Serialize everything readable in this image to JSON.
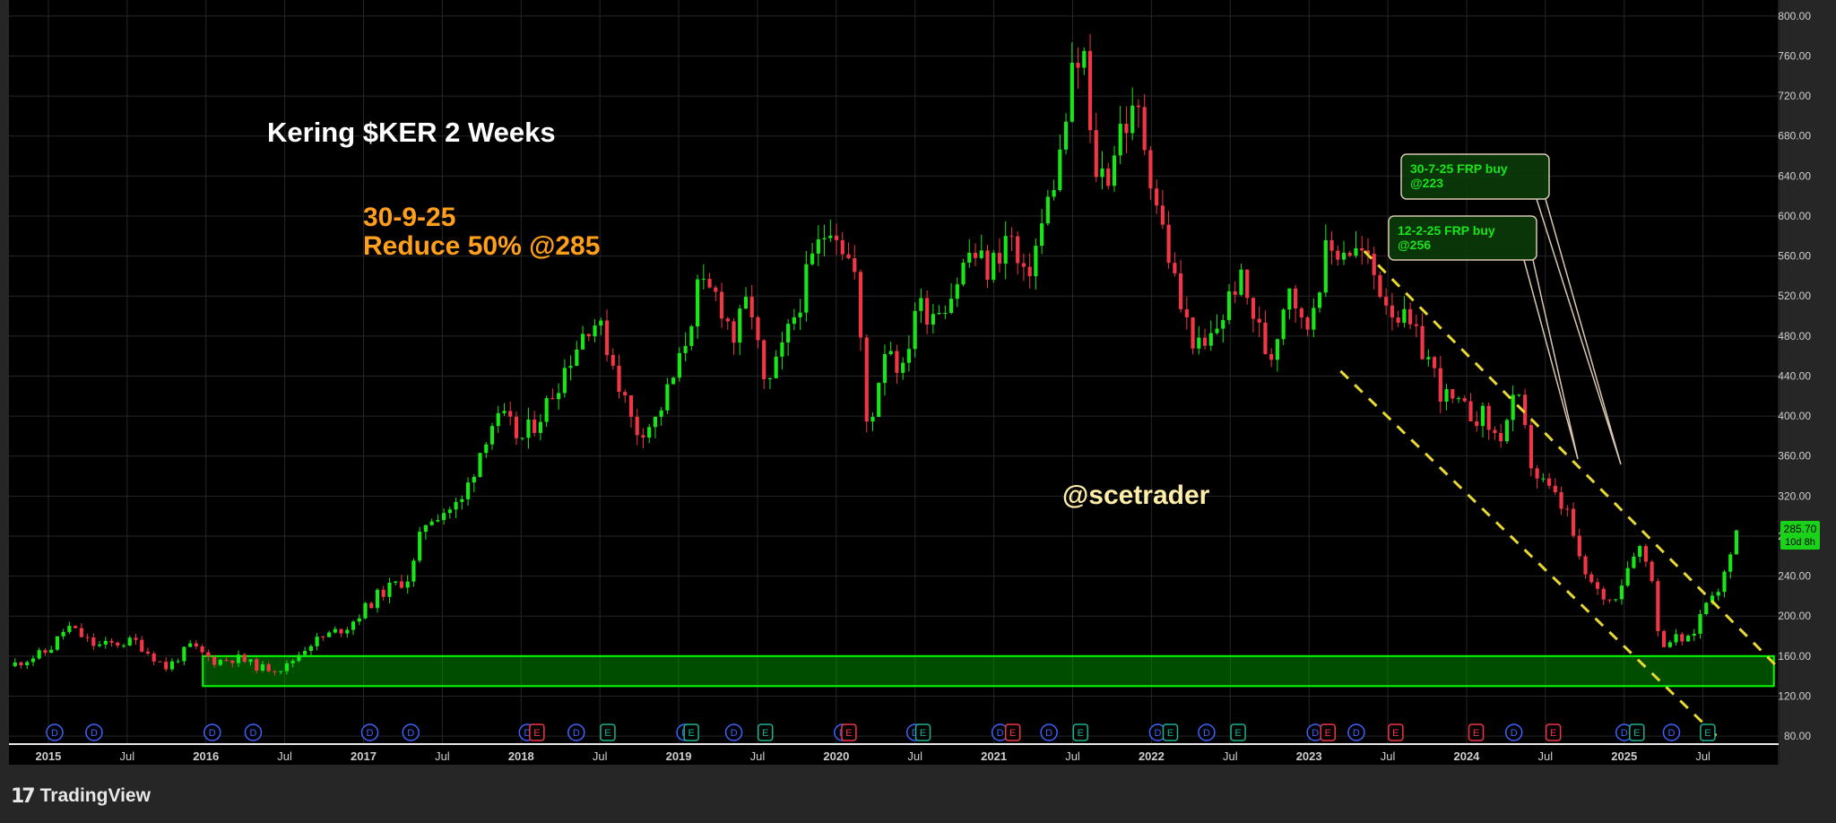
{
  "brand": {
    "mark": "17",
    "name": "TradingView"
  },
  "annotations": {
    "title": "Kering $KER 2 Weeks",
    "trade_date": "30-9-25",
    "trade_action": "Reduce 50% @285",
    "handle": "@scetrader",
    "callout_1": {
      "line1": "30-7-25 FRP buy",
      "line2": "@223"
    },
    "callout_2": {
      "line1": "12-2-25 FRP buy",
      "line2": "@256"
    }
  },
  "price_badge": {
    "price": "285.70",
    "countdown": "10d 8h"
  },
  "colors": {
    "background": "#000000",
    "up": "#19e619",
    "down": "#f23645",
    "title": "#ffffff",
    "orange": "#ff9f1a",
    "handle": "#ffeea8",
    "channel": "#e8d832",
    "zone": "#00ff00",
    "dividend_event": "#3d63ff",
    "earnings_event_red": "#f23645",
    "earnings_event_teal": "#1ab290"
  },
  "events": [
    {
      "t": 2015.04,
      "k": "D"
    },
    {
      "t": 2015.29,
      "k": "D"
    },
    {
      "t": 2016.04,
      "k": "D"
    },
    {
      "t": 2016.3,
      "k": "D"
    },
    {
      "t": 2017.04,
      "k": "D"
    },
    {
      "t": 2017.3,
      "k": "D"
    },
    {
      "t": 2018.04,
      "k": "D"
    },
    {
      "t": 2018.1,
      "k": "E",
      "c": "red"
    },
    {
      "t": 2018.35,
      "k": "D"
    },
    {
      "t": 2018.55,
      "k": "E",
      "c": "teal"
    },
    {
      "t": 2019.04,
      "k": "D"
    },
    {
      "t": 2019.08,
      "k": "E",
      "c": "teal"
    },
    {
      "t": 2019.35,
      "k": "D"
    },
    {
      "t": 2019.55,
      "k": "E",
      "c": "teal"
    },
    {
      "t": 2020.04,
      "k": "D"
    },
    {
      "t": 2020.08,
      "k": "E",
      "c": "red"
    },
    {
      "t": 2020.5,
      "k": "D"
    },
    {
      "t": 2020.55,
      "k": "E",
      "c": "teal"
    },
    {
      "t": 2021.04,
      "k": "D"
    },
    {
      "t": 2021.12,
      "k": "E",
      "c": "red"
    },
    {
      "t": 2021.35,
      "k": "D"
    },
    {
      "t": 2021.55,
      "k": "E",
      "c": "teal"
    },
    {
      "t": 2022.04,
      "k": "D"
    },
    {
      "t": 2022.12,
      "k": "E",
      "c": "teal"
    },
    {
      "t": 2022.35,
      "k": "D"
    },
    {
      "t": 2022.55,
      "k": "E",
      "c": "teal"
    },
    {
      "t": 2023.04,
      "k": "D"
    },
    {
      "t": 2023.12,
      "k": "E",
      "c": "red"
    },
    {
      "t": 2023.3,
      "k": "D"
    },
    {
      "t": 2023.55,
      "k": "E",
      "c": "red"
    },
    {
      "t": 2024.06,
      "k": "E",
      "c": "red"
    },
    {
      "t": 2024.3,
      "k": "D"
    },
    {
      "t": 2024.55,
      "k": "E",
      "c": "red"
    },
    {
      "t": 2025.0,
      "k": "D"
    },
    {
      "t": 2025.08,
      "k": "E",
      "c": "teal"
    },
    {
      "t": 2025.3,
      "k": "D"
    },
    {
      "t": 2025.53,
      "k": "E",
      "c": "teal"
    }
  ],
  "chart_data": {
    "type": "candlestick",
    "title": "Kering $KER 2 Weeks",
    "interval": "2 weeks",
    "y_scale": "linear",
    "ylim": [
      72,
      816
    ],
    "xlim": [
      2014.75,
      2025.98
    ],
    "y_ticks": [
      "80.00",
      "120.00",
      "160.00",
      "200.00",
      "240.00",
      "280.00",
      "320.00",
      "360.00",
      "400.00",
      "440.00",
      "480.00",
      "520.00",
      "560.00",
      "600.00",
      "640.00",
      "680.00",
      "720.00",
      "760.00",
      "800.00"
    ],
    "x_ticks": [
      {
        "t": 2015.0,
        "label": "2015"
      },
      {
        "t": 2015.5,
        "label": "Jul"
      },
      {
        "t": 2016.0,
        "label": "2016"
      },
      {
        "t": 2016.5,
        "label": "Jul"
      },
      {
        "t": 2017.0,
        "label": "2017"
      },
      {
        "t": 2017.5,
        "label": "Jul"
      },
      {
        "t": 2018.0,
        "label": "2018"
      },
      {
        "t": 2018.5,
        "label": "Jul"
      },
      {
        "t": 2019.0,
        "label": "2019"
      },
      {
        "t": 2019.5,
        "label": "Jul"
      },
      {
        "t": 2020.0,
        "label": "2020"
      },
      {
        "t": 2020.5,
        "label": "Jul"
      },
      {
        "t": 2021.0,
        "label": "2021"
      },
      {
        "t": 2021.5,
        "label": "Jul"
      },
      {
        "t": 2022.0,
        "label": "2022"
      },
      {
        "t": 2022.5,
        "label": "Jul"
      },
      {
        "t": 2023.0,
        "label": "2023"
      },
      {
        "t": 2023.5,
        "label": "Jul"
      },
      {
        "t": 2024.0,
        "label": "2024"
      },
      {
        "t": 2024.5,
        "label": "Jul"
      },
      {
        "t": 2025.0,
        "label": "2025"
      },
      {
        "t": 2025.5,
        "label": "Jul"
      }
    ],
    "grid": true,
    "last_price": 285.7,
    "price_path": [
      [
        2014.75,
        150
      ],
      [
        2015.0,
        165
      ],
      [
        2015.12,
        190
      ],
      [
        2015.3,
        170
      ],
      [
        2015.55,
        175
      ],
      [
        2015.75,
        148
      ],
      [
        2015.9,
        170
      ],
      [
        2016.05,
        155
      ],
      [
        2016.2,
        158
      ],
      [
        2016.35,
        148
      ],
      [
        2016.5,
        148
      ],
      [
        2016.65,
        172
      ],
      [
        2016.9,
        190
      ],
      [
        2017.1,
        222
      ],
      [
        2017.3,
        240
      ],
      [
        2017.38,
        292
      ],
      [
        2017.45,
        302
      ],
      [
        2017.62,
        312
      ],
      [
        2017.8,
        392
      ],
      [
        2017.9,
        395
      ],
      [
        2018.0,
        375
      ],
      [
        2018.15,
        408
      ],
      [
        2018.32,
        462
      ],
      [
        2018.45,
        500
      ],
      [
        2018.55,
        470
      ],
      [
        2018.72,
        385
      ],
      [
        2018.85,
        395
      ],
      [
        2019.0,
        450
      ],
      [
        2019.12,
        525
      ],
      [
        2019.25,
        520
      ],
      [
        2019.35,
        478
      ],
      [
        2019.45,
        520
      ],
      [
        2019.55,
        420
      ],
      [
        2019.68,
        475
      ],
      [
        2019.85,
        555
      ],
      [
        2019.97,
        600
      ],
      [
        2020.12,
        540
      ],
      [
        2020.2,
        380
      ],
      [
        2020.32,
        480
      ],
      [
        2020.42,
        440
      ],
      [
        2020.5,
        510
      ],
      [
        2020.6,
        505
      ],
      [
        2020.72,
        520
      ],
      [
        2020.85,
        565
      ],
      [
        2020.97,
        545
      ],
      [
        2021.1,
        585
      ],
      [
        2021.18,
        530
      ],
      [
        2021.28,
        575
      ],
      [
        2021.42,
        660
      ],
      [
        2021.5,
        740
      ],
      [
        2021.58,
        760
      ],
      [
        2021.62,
        650
      ],
      [
        2021.72,
        640
      ],
      [
        2021.8,
        690
      ],
      [
        2021.92,
        700
      ],
      [
        2022.0,
        640
      ],
      [
        2022.08,
        580
      ],
      [
        2022.2,
        500
      ],
      [
        2022.32,
        460
      ],
      [
        2022.45,
        500
      ],
      [
        2022.55,
        540
      ],
      [
        2022.65,
        500
      ],
      [
        2022.75,
        455
      ],
      [
        2022.88,
        540
      ],
      [
        2022.97,
        478
      ],
      [
        2023.1,
        560
      ],
      [
        2023.22,
        570
      ],
      [
        2023.35,
        560
      ],
      [
        2023.48,
        520
      ],
      [
        2023.62,
        490
      ],
      [
        2023.75,
        460
      ],
      [
        2023.85,
        420
      ],
      [
        2023.97,
        405
      ],
      [
        2024.1,
        400
      ],
      [
        2024.2,
        375
      ],
      [
        2024.32,
        420
      ],
      [
        2024.42,
        345
      ],
      [
        2024.55,
        320
      ],
      [
        2024.65,
        300
      ],
      [
        2024.72,
        250
      ],
      [
        2024.82,
        225
      ],
      [
        2024.92,
        215
      ],
      [
        2025.0,
        240
      ],
      [
        2025.08,
        275
      ],
      [
        2025.18,
        240
      ],
      [
        2025.22,
        172
      ],
      [
        2025.32,
        178
      ],
      [
        2025.42,
        175
      ],
      [
        2025.48,
        200
      ],
      [
        2025.55,
        225
      ],
      [
        2025.62,
        232
      ],
      [
        2025.68,
        262
      ],
      [
        2025.73,
        285.7
      ]
    ],
    "support_zone": {
      "t0": 2015.98,
      "t1": 2025.95,
      "low": 130,
      "high": 160
    },
    "channel_lines": [
      {
        "t0": 2023.35,
        "p0": 565,
        "t1": 2025.98,
        "p1": 148
      },
      {
        "t0": 2023.2,
        "p0": 445,
        "t1": 2025.6,
        "p1": 78
      }
    ]
  }
}
